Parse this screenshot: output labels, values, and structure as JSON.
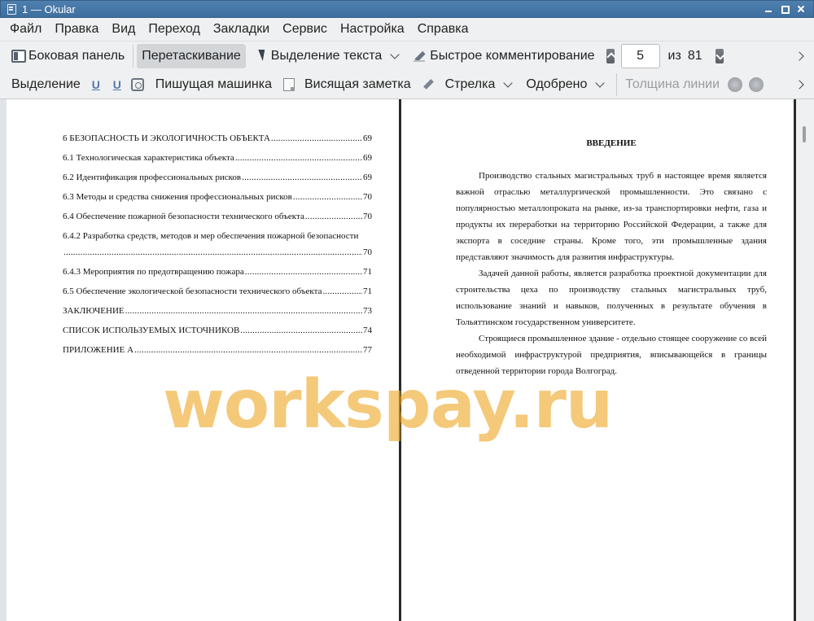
{
  "window": {
    "title": "1  — Okular"
  },
  "menubar": {
    "items": [
      "Файл",
      "Правка",
      "Вид",
      "Переход",
      "Закладки",
      "Сервис",
      "Настройка",
      "Справка"
    ]
  },
  "toolbar1": {
    "sidebar_label": "Боковая панель",
    "drag_label": "Перетаскивание",
    "text_select_label": "Выделение текста",
    "quick_comment_label": "Быстрое комментирование",
    "current_page": "5",
    "of_label": "из",
    "total_pages": "81"
  },
  "toolbar2": {
    "selection_label": "Выделение",
    "typewriter_label": "Пишущая машинка",
    "note_label": "Висящая заметка",
    "arrow_label": "Стрелка",
    "approved_label": "Одобрено",
    "line_width_label": "Толщина линии"
  },
  "left_page": {
    "toc": [
      {
        "title": "6 БЕЗОПАСНОСТЬ И ЭКОЛОГИЧНОСТЬ ОБЪЕКТА",
        "page": "69"
      },
      {
        "title": "6.1 Технологическая характеристика объекта",
        "page": "69"
      },
      {
        "title": "6.2 Идентификация профессиональных рисков",
        "page": "69"
      },
      {
        "title": "6.3 Методы и средства снижения профессиональных рисков",
        "page": "70"
      },
      {
        "title": "6.4 Обеспечение пожарной безопасности технического объекта",
        "page": "70"
      },
      {
        "title": "6.4.2 Разработка средств, методов и мер обеспечения пожарной безопасности",
        "page": "70"
      },
      {
        "title": "6.4.3 Мероприятия по предотвращению пожара",
        "page": "71"
      },
      {
        "title": "6.5 Обеспечение экологической безопасности технического объекта",
        "page": "71"
      },
      {
        "title": "ЗАКЛЮЧЕНИЕ",
        "page": "73"
      },
      {
        "title": "СПИСОК ИСПОЛЬЗУЕМЫХ ИСТОЧНИКОВ",
        "page": "74"
      },
      {
        "title": "ПРИЛОЖЕНИЕ А",
        "page": "77"
      }
    ]
  },
  "right_page": {
    "heading": "ВВЕДЕНИЕ",
    "paragraphs": [
      "Производство стальных магистральных труб в настоящее время является важной отраслью металлургической промышленности. Это связано с популярностью металлопроката на рынке, из-за транспортировки нефти, газа и продукты их переработки на территорию Российской Федерации, а также для экспорта в соседние страны. Кроме того, эти промышленные здания представляют значимость для развития инфраструктуры.",
      "Задачей данной работы, является разработка проектной документации для строительства цеха по производству стальных магистральных труб, использование знаний и навыков, полученных в результате обучения в Тольяттинском государственном университете.",
      "Строящиеся промышленное здание - отдельно стоящее сооружение со всей необходимой инфраструктурой предприятия, вписывающейся в границы отведенной территории города Волгоград."
    ]
  },
  "watermark": "workspay.ru"
}
